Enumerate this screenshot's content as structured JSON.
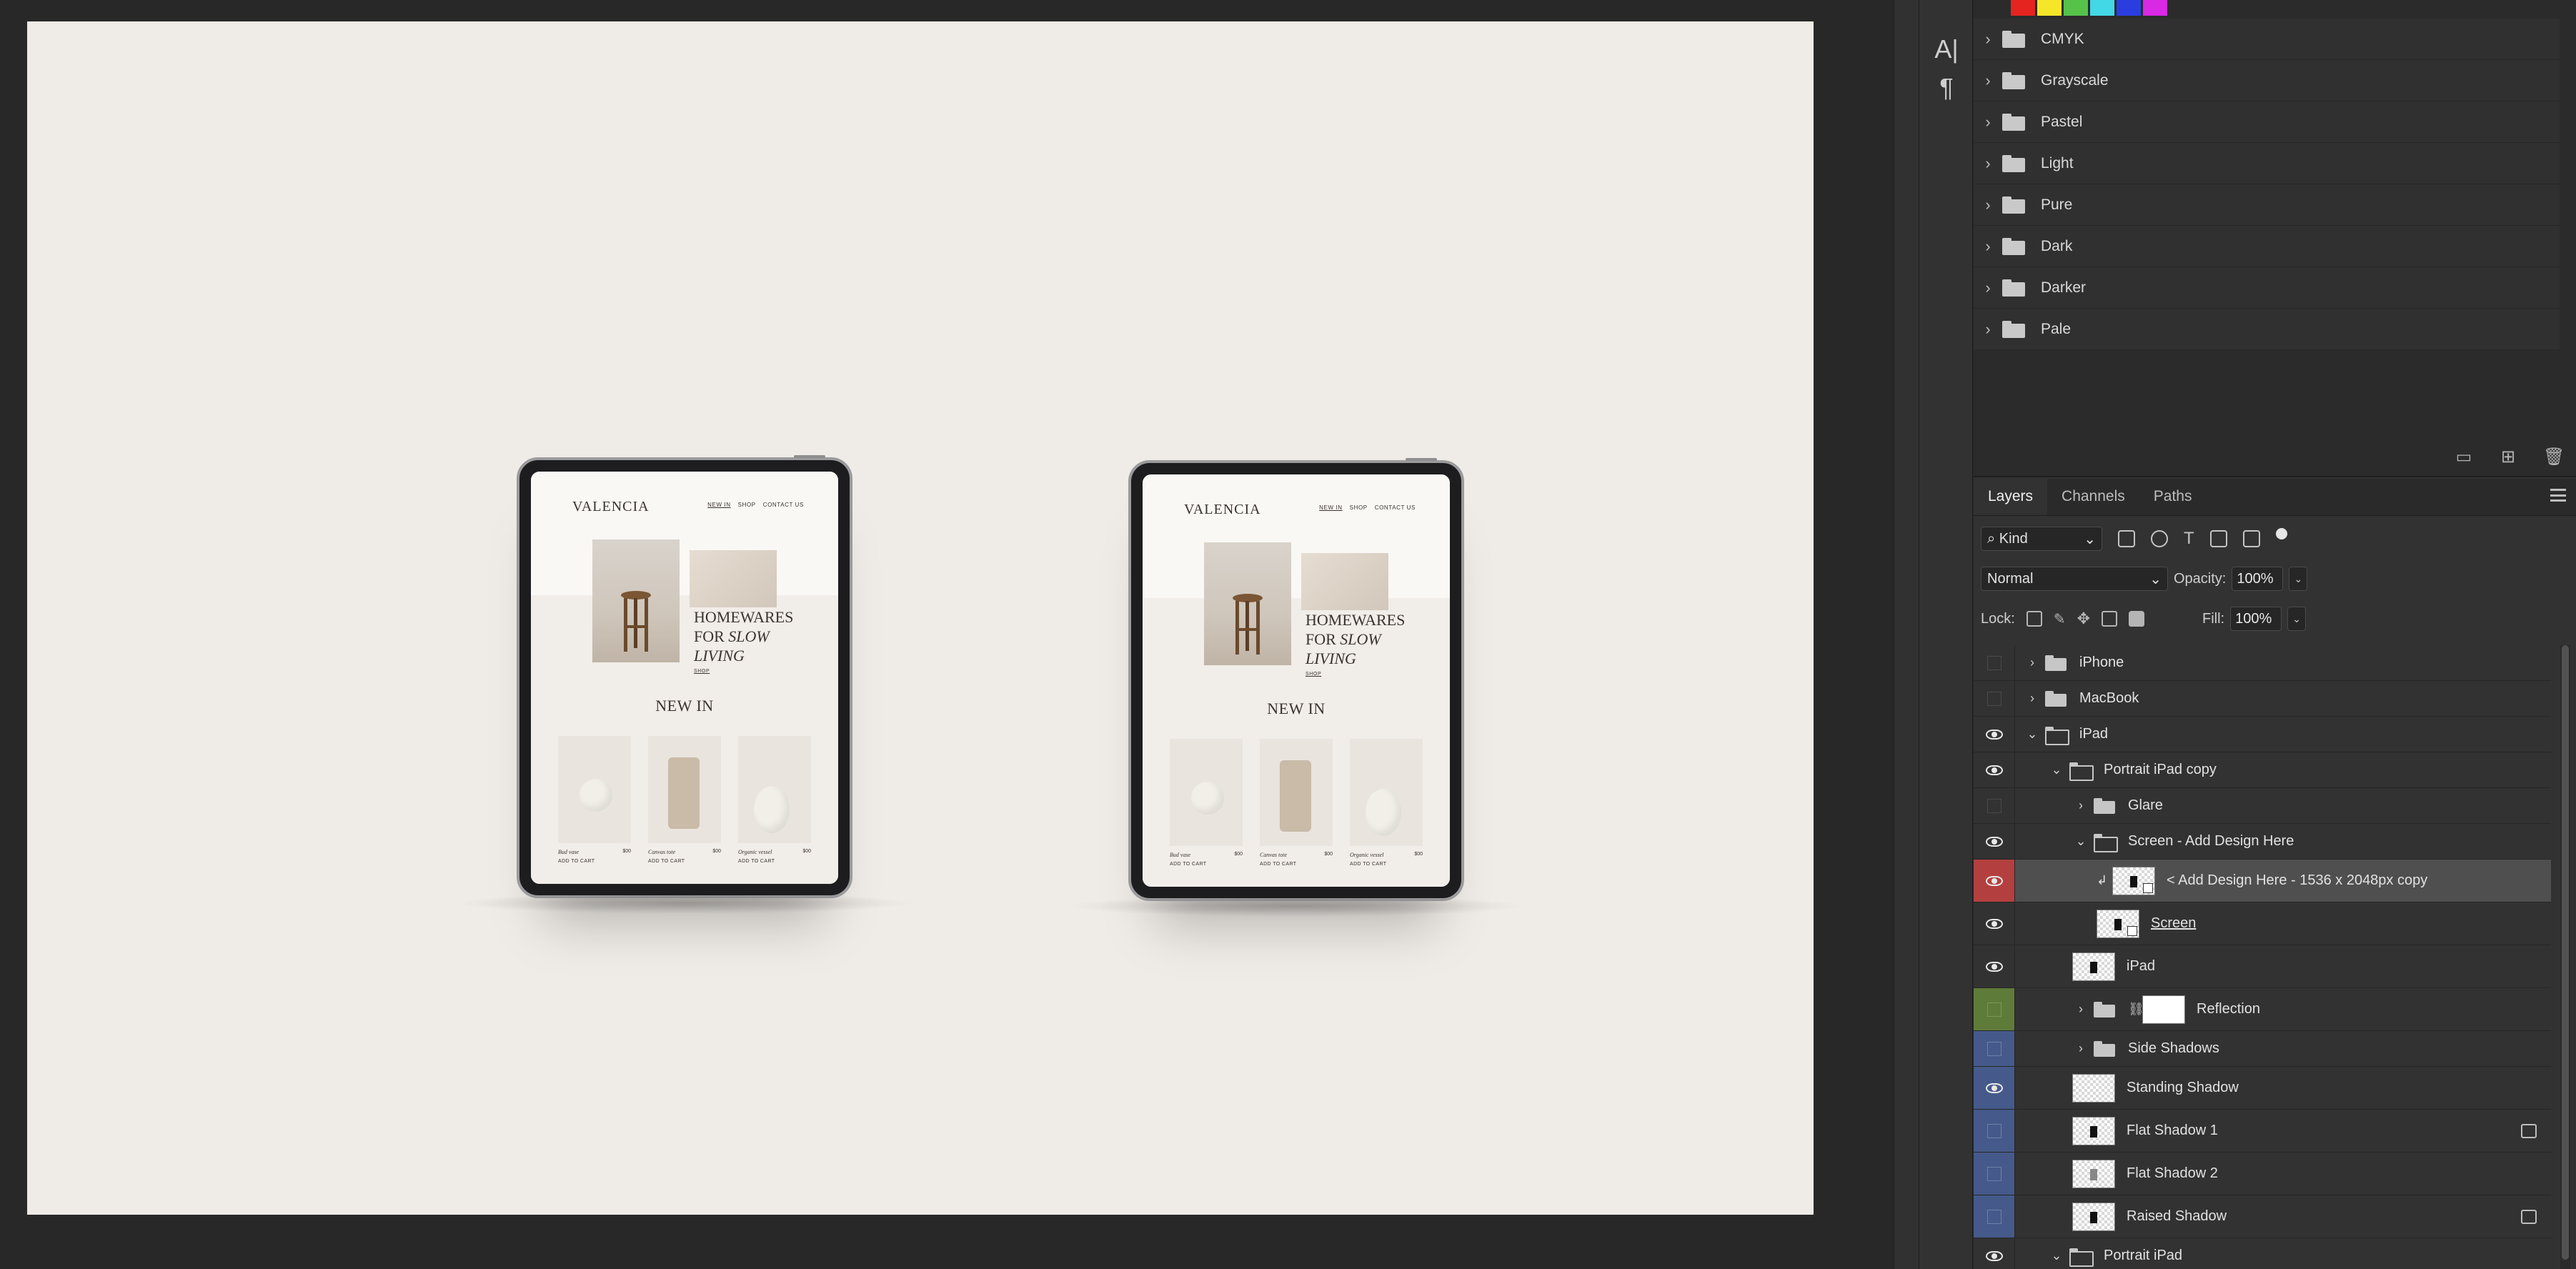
{
  "canvas": {
    "background": "#efebe6",
    "devices": [
      {
        "logo": "VALENCIA",
        "nav": [
          "NEW IN",
          "SHOP",
          "CONTACT US"
        ],
        "hero_title_line1": "HOMEWARES",
        "hero_title_line2a": "FOR ",
        "hero_title_line2b": "SLOW",
        "hero_title_line3": "LIVING",
        "hero_shop": "SHOP",
        "new_in": "NEW IN",
        "products": [
          {
            "name": "Bud vase",
            "price": "$00",
            "button": "ADD TO CART"
          },
          {
            "name": "Canvas tote",
            "price": "$00",
            "button": "ADD TO CART"
          },
          {
            "name": "Organic vessel",
            "price": "$00",
            "button": "ADD TO CART"
          }
        ]
      },
      {
        "logo": "VALENCIA",
        "nav": [
          "NEW IN",
          "SHOP",
          "CONTACT US"
        ],
        "hero_title_line1": "HOMEWARES",
        "hero_title_line2a": "FOR ",
        "hero_title_line2b": "SLOW",
        "hero_title_line3": "LIVING",
        "hero_shop": "SHOP",
        "new_in": "NEW IN",
        "products": [
          {
            "name": "Bud vase",
            "price": "$00",
            "button": "ADD TO CART"
          },
          {
            "name": "Canvas tote",
            "price": "$00",
            "button": "ADD TO CART"
          },
          {
            "name": "Organic vessel",
            "price": "$00",
            "button": "ADD TO CART"
          }
        ]
      }
    ]
  },
  "mini_tools": {
    "character_icon": "A|",
    "paragraph_icon": "¶"
  },
  "swatches": {
    "strip_colors": [
      "#e52420",
      "#f5e62a",
      "#56c24a",
      "#42d8e5",
      "#2a3ee0",
      "#d829e4"
    ],
    "groups": [
      "CMYK",
      "Grayscale",
      "Pastel",
      "Light",
      "Pure",
      "Dark",
      "Darker",
      "Pale"
    ],
    "footer_icons": [
      "new-group-icon",
      "new-swatch-icon",
      "trash-icon"
    ]
  },
  "layers_panel": {
    "tabs": [
      "Layers",
      "Channels",
      "Paths"
    ],
    "active_tab": "Layers",
    "filter_kind": "Kind",
    "blend_mode": "Normal",
    "opacity_label": "Opacity:",
    "opacity_value": "100%",
    "lock_label": "Lock:",
    "fill_label": "Fill:",
    "fill_value": "100%",
    "layers": [
      {
        "name": "iPhone",
        "visible": false,
        "type": "group",
        "expanded": false,
        "depth": 0,
        "color": ""
      },
      {
        "name": "MacBook",
        "visible": false,
        "type": "group",
        "expanded": false,
        "depth": 0,
        "color": ""
      },
      {
        "name": "iPad",
        "visible": true,
        "type": "group",
        "expanded": true,
        "depth": 0,
        "color": ""
      },
      {
        "name": "Portrait iPad copy",
        "visible": true,
        "type": "group",
        "expanded": true,
        "depth": 1,
        "color": ""
      },
      {
        "name": "Glare",
        "visible": false,
        "type": "group",
        "expanded": false,
        "depth": 2,
        "color": ""
      },
      {
        "name": "Screen - Add Design Here",
        "visible": true,
        "type": "group",
        "expanded": true,
        "depth": 2,
        "color": ""
      },
      {
        "name": "< Add Design Here - 1536 x 2048px copy",
        "visible": true,
        "type": "smart",
        "depth": 3,
        "color": "red",
        "selected": true,
        "clipped": true
      },
      {
        "name": "Screen",
        "visible": true,
        "type": "smart",
        "depth": 3,
        "color": "",
        "underline": true
      },
      {
        "name": "iPad",
        "visible": true,
        "type": "pixel",
        "depth": 2,
        "color": ""
      },
      {
        "name": "Reflection",
        "visible": false,
        "type": "group-mask",
        "expanded": false,
        "depth": 2,
        "color": "green"
      },
      {
        "name": "Side Shadows",
        "visible": false,
        "type": "group",
        "expanded": false,
        "depth": 2,
        "color": "blue"
      },
      {
        "name": "Standing Shadow",
        "visible": true,
        "type": "pixel-empty",
        "depth": 2,
        "color": "blue"
      },
      {
        "name": "Flat Shadow 1",
        "visible": false,
        "type": "pixel",
        "depth": 2,
        "color": "blue",
        "fx": true
      },
      {
        "name": "Flat Shadow 2",
        "visible": false,
        "type": "pixel-gray",
        "depth": 2,
        "color": "blue"
      },
      {
        "name": "Raised Shadow",
        "visible": false,
        "type": "pixel",
        "depth": 2,
        "color": "blue",
        "fx": true
      },
      {
        "name": "Portrait iPad",
        "visible": true,
        "type": "group",
        "expanded": true,
        "depth": 1,
        "color": ""
      }
    ]
  }
}
